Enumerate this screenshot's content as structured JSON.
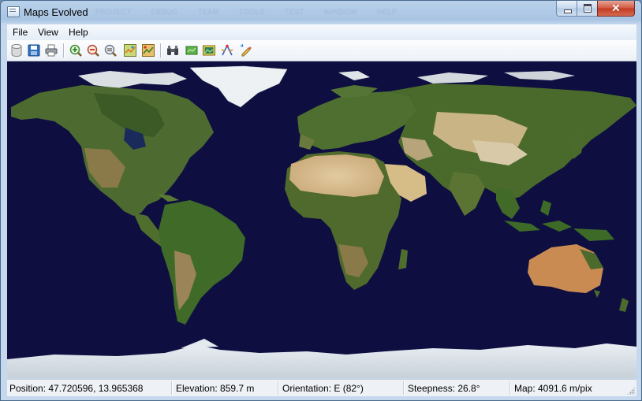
{
  "window": {
    "title": "Maps Evolved",
    "ghost_menu": [
      "PROJECT",
      "DEBUG",
      "TEAM",
      "TOOLS",
      "TEST",
      "WINDOW",
      "HELP"
    ]
  },
  "menubar": {
    "items": [
      "File",
      "View",
      "Help"
    ]
  },
  "toolbar": {
    "buttons": [
      "database-icon",
      "save-icon",
      "print-icon",
      "zoom-in-icon",
      "zoom-out-icon",
      "zoom-reset-icon",
      "map-layer-icon",
      "map-layer-alt-icon",
      "binoculars-icon",
      "map-green-icon",
      "map-image-icon",
      "compass-tool-icon",
      "pencil-tool-icon"
    ]
  },
  "status": {
    "position": "Position: 47.720596, 13.965368",
    "elevation": "Elevation: 859.7 m",
    "orientation": "Orientation:   E (82°)",
    "steepness": "Steepness: 26.8°",
    "map": "Map: 4091.6 m/pix"
  },
  "colors": {
    "ocean": "#0e0f40",
    "land": "#4a6a2c",
    "desert": "#d4bf8e",
    "ice": "#eef2f5",
    "close_button": "#c9432a"
  }
}
